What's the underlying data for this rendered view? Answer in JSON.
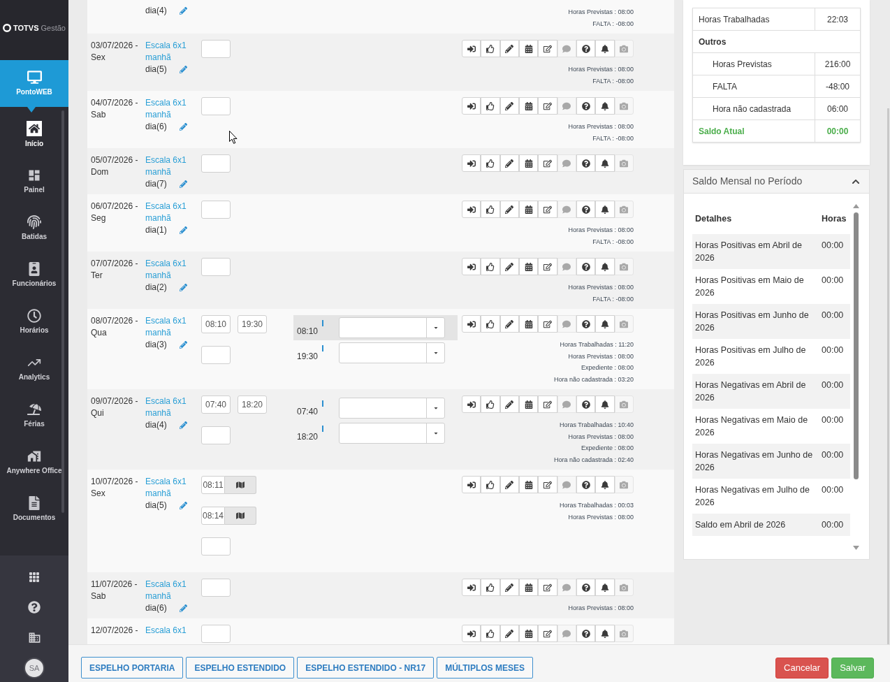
{
  "sidebar": {
    "logo": {
      "brand": "TOTVS",
      "product": "Gestão"
    },
    "module": {
      "label": "PontoWEB",
      "selected": true
    },
    "items": [
      {
        "label": "Início",
        "selected": true
      },
      {
        "label": "Painel",
        "selected": false
      },
      {
        "label": "Batidas",
        "selected": false
      },
      {
        "label": "Funcionários",
        "selected": false
      },
      {
        "label": "Horários",
        "selected": false
      },
      {
        "label": "Analytics",
        "selected": false
      },
      {
        "label": "Férias",
        "selected": false
      },
      {
        "label": "Anywhere Office",
        "selected": false
      },
      {
        "label": "Documentos",
        "selected": false
      }
    ],
    "avatar": {
      "initials": "SA"
    }
  },
  "action_buttons": [
    {
      "disabled": false
    },
    {
      "disabled": false
    },
    {
      "disabled": false
    },
    {
      "disabled": false
    },
    {
      "disabled": false
    },
    {
      "disabled": true
    },
    {
      "disabled": false
    },
    {
      "disabled": false
    },
    {
      "disabled": true
    }
  ],
  "days": [
    {
      "kind": "clipped_top",
      "schedule_day": "dia(4)",
      "summary": [
        "Horas Previstas : 08:00",
        "FALTA : -08:00"
      ]
    },
    {
      "kind": "full",
      "date": "03/07/2026 -",
      "weekday": "Sex",
      "schedule": "Escala 6x1 manhã",
      "schedule_day": "dia(5)",
      "summary": [
        "Horas Previstas : 08:00",
        "FALTA : -08:00"
      ]
    },
    {
      "kind": "full",
      "date": "04/07/2026 -",
      "weekday": "Sab",
      "schedule": "Escala 6x1 manhã",
      "schedule_day": "dia(6)",
      "summary": [
        "Horas Previstas : 08:00",
        "FALTA : -08:00"
      ]
    },
    {
      "kind": "full",
      "date": "05/07/2026 -",
      "weekday": "Dom",
      "schedule": "Escala 6x1 manhã",
      "schedule_day": "dia(7)"
    },
    {
      "kind": "full",
      "date": "06/07/2026 -",
      "weekday": "Seg",
      "schedule": "Escala 6x1 manhã",
      "schedule_day": "dia(1)",
      "summary": [
        "Horas Previstas : 08:00",
        "FALTA : -08:00"
      ]
    },
    {
      "kind": "full",
      "date": "07/07/2026 -",
      "weekday": "Ter",
      "schedule": "Escala 6x1 manhã",
      "schedule_day": "dia(2)",
      "summary": [
        "Horas Previstas : 08:00",
        "FALTA : -08:00"
      ]
    },
    {
      "kind": "full",
      "date": "08/07/2026 -",
      "weekday": "Qua",
      "schedule": "Escala 6x1 manhã",
      "schedule_day": "dia(3)",
      "punch_lines": [
        {
          "kind": "plain",
          "values": [
            "08:10",
            "19:30"
          ]
        }
      ],
      "markings": [
        {
          "time": "08:10",
          "highlighted": true
        },
        {
          "time": "19:30",
          "highlighted": false
        }
      ],
      "summary": [
        "Horas Trabalhadas : 11:20",
        "Horas Previstas : 08:00",
        "Expediente : 08:00",
        "Hora não cadastrada : 03:20"
      ]
    },
    {
      "kind": "full",
      "date": "09/07/2026 -",
      "weekday": "Qui",
      "schedule": "Escala 6x1 manhã",
      "schedule_day": "dia(4)",
      "punch_lines": [
        {
          "kind": "plain",
          "values": [
            "07:40",
            "18:20"
          ]
        }
      ],
      "markings": [
        {
          "time": "07:40",
          "highlighted": false
        },
        {
          "time": "18:20",
          "highlighted": false
        }
      ],
      "summary": [
        "Horas Trabalhadas : 10:40",
        "Horas Previstas : 08:00",
        "Expediente : 08:00",
        "Hora não cadastrada : 02:40"
      ]
    },
    {
      "kind": "full",
      "date": "10/07/2026 -",
      "weekday": "Sex",
      "schedule": "Escala 6x1 manhã",
      "schedule_day": "dia(5)",
      "punch_lines": [
        {
          "kind": "located",
          "values": [
            "08:11"
          ]
        },
        {
          "kind": "located",
          "values": [
            "08:14"
          ]
        }
      ],
      "summary": [
        "Horas Trabalhadas : 00:03",
        "Horas Previstas : 08:00"
      ]
    },
    {
      "kind": "full",
      "date": "11/07/2026 -",
      "weekday": "Sab",
      "schedule": "Escala 6x1 manhã",
      "schedule_day": "dia(6)",
      "summary": [
        "Horas Previstas : 08:00"
      ]
    },
    {
      "kind": "clipped_bottom",
      "date": "12/07/2026 -",
      "schedule": "Escala 6x1"
    }
  ],
  "totals": {
    "rows": [
      {
        "kind": "row",
        "label": "Horas Trabalhadas",
        "value": "22:03"
      },
      {
        "kind": "group",
        "label": "Outros"
      },
      {
        "kind": "sub",
        "label": "Horas Previstas",
        "value": "216:00"
      },
      {
        "kind": "sub",
        "label": "FALTA",
        "value": "-48:00"
      },
      {
        "kind": "sub",
        "label": "Hora não cadastrada",
        "value": "06:00"
      },
      {
        "kind": "total",
        "label": "Saldo Atual",
        "value": "00:00"
      }
    ]
  },
  "monthly_balance": {
    "title": "Saldo Mensal no Período",
    "expanded": true,
    "columns": [
      "Detalhes",
      "Horas"
    ],
    "rows": [
      {
        "detail": "Horas Positivas em Abril de 2026",
        "hours": "00:00"
      },
      {
        "detail": "Horas Positivas em Maio de 2026",
        "hours": "00:00"
      },
      {
        "detail": "Horas Positivas em Junho de 2026",
        "hours": "00:00"
      },
      {
        "detail": "Horas Positivas em Julho de 2026",
        "hours": "00:00"
      },
      {
        "detail": "Horas Negativas em Abril de 2026",
        "hours": "00:00"
      },
      {
        "detail": "Horas Negativas em Maio de 2026",
        "hours": "00:00"
      },
      {
        "detail": "Horas Negativas em Junho de 2026",
        "hours": "00:00"
      },
      {
        "detail": "Horas Negativas em Julho de 2026",
        "hours": "00:00"
      },
      {
        "detail": "Saldo em Abril de 2026",
        "hours": "00:00"
      }
    ]
  },
  "footer": {
    "report_buttons": [
      "ESPELHO PORTARIA",
      "ESPELHO ESTENDIDO",
      "ESPELHO ESTENDIDO - NR17",
      "MÚLTIPLOS MESES"
    ],
    "actions": [
      {
        "label": "Cancelar",
        "kind": "danger"
      },
      {
        "label": "Salvar",
        "kind": "success"
      }
    ]
  }
}
